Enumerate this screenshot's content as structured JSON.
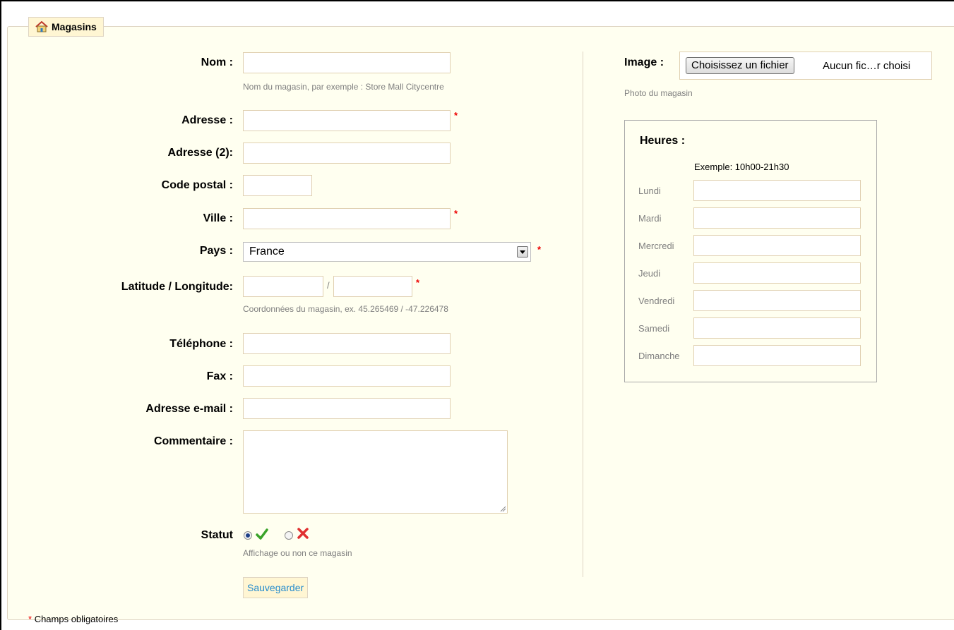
{
  "legend": {
    "title": "Magasins",
    "icon": "home-icon"
  },
  "fields": {
    "nom": {
      "label": "Nom :",
      "value": "",
      "hint": "Nom du magasin, par exemple : Store Mall Citycentre"
    },
    "adresse": {
      "label": "Adresse :",
      "value": "",
      "required": "*"
    },
    "adresse2": {
      "label": "Adresse (2):",
      "value": ""
    },
    "code_postal": {
      "label": "Code postal :",
      "value": ""
    },
    "ville": {
      "label": "Ville :",
      "value": "",
      "required": "*"
    },
    "pays": {
      "label": "Pays :",
      "selected": "France",
      "required": "*"
    },
    "latlng": {
      "label": "Latitude / Longitude:",
      "separator": "/",
      "required": "*",
      "hint": "Coordonnées du magasin, ex. 45.265469 / -47.226478"
    },
    "telephone": {
      "label": "Téléphone :",
      "value": ""
    },
    "fax": {
      "label": "Fax :",
      "value": ""
    },
    "email": {
      "label": "Adresse e-mail :",
      "value": ""
    },
    "commentaire": {
      "label": "Commentaire :",
      "value": ""
    },
    "statut": {
      "label": "Statut",
      "hint": "Affichage ou non ce magasin",
      "enabled": true
    }
  },
  "save_button": "Sauvegarder",
  "image": {
    "label": "Image :",
    "button": "Choisissez un fichier",
    "filename": "Aucun fic…r choisi",
    "hint": "Photo du magasin"
  },
  "hours": {
    "title": "Heures :",
    "example": "Exemple: 10h00-21h30",
    "days": [
      "Lundi",
      "Mardi",
      "Mercredi",
      "Jeudi",
      "Vendredi",
      "Samedi",
      "Dimanche"
    ]
  },
  "footer": {
    "star": "*",
    "text": "Champs obligatoires"
  },
  "colors": {
    "accent": "#268ccd",
    "required": "#ee0000",
    "check": "#3aa32a",
    "cross": "#e03030"
  }
}
